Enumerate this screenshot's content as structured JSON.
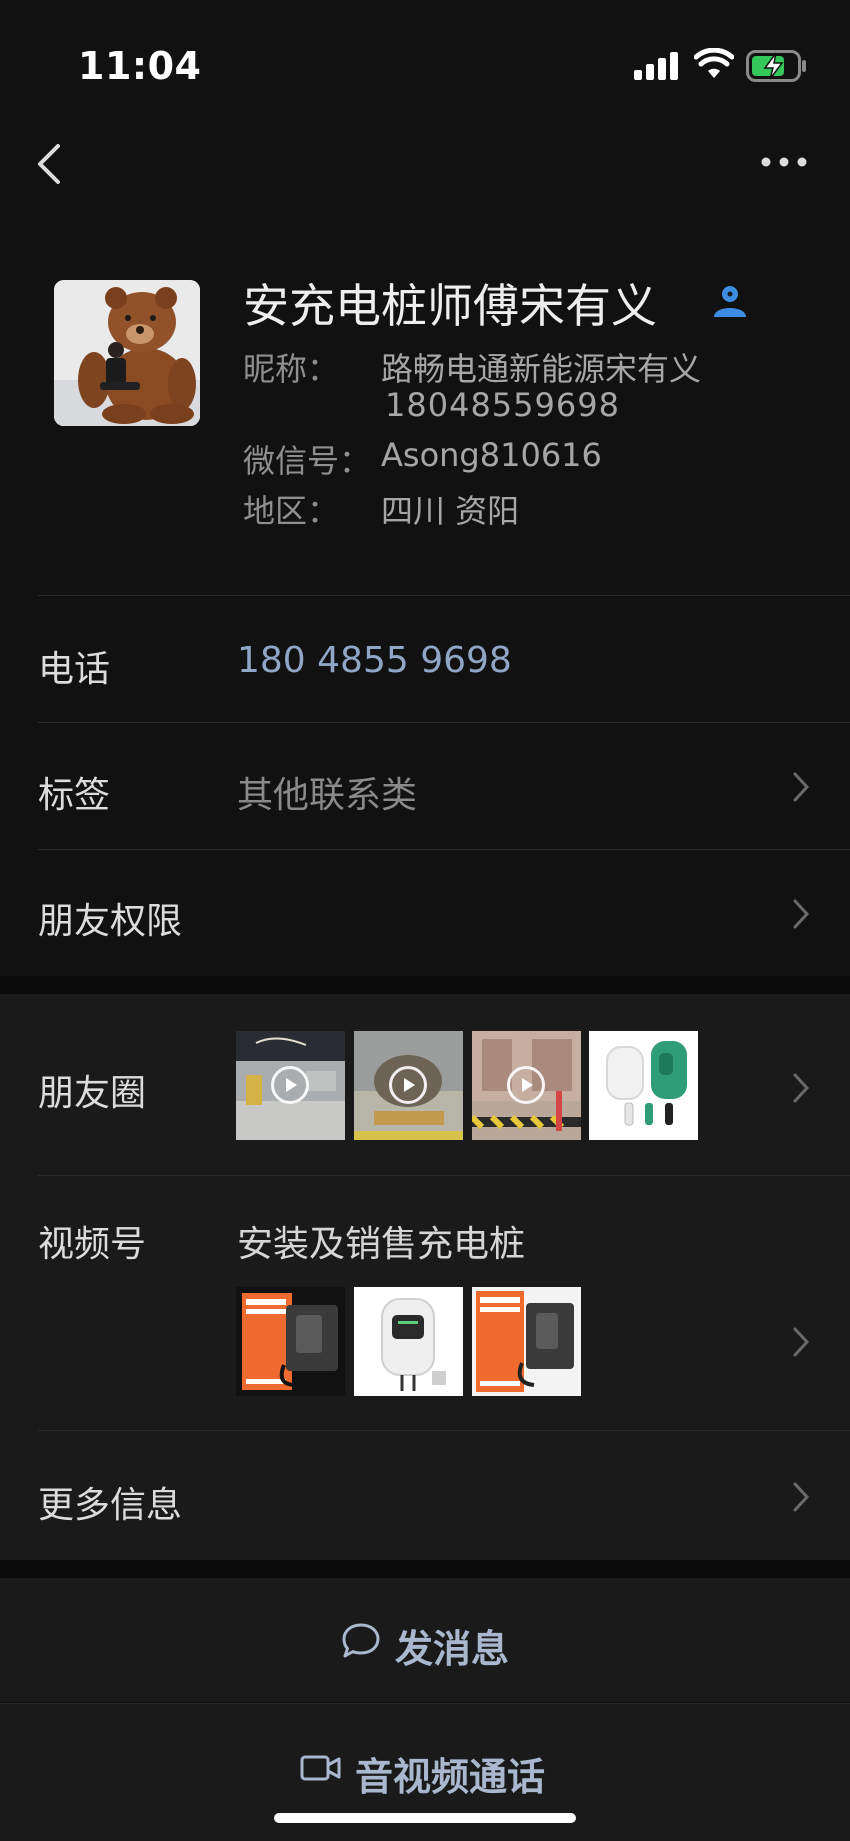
{
  "status_bar": {
    "time": "11:04"
  },
  "profile": {
    "name": "安充电桩师傅宋有义",
    "nickname_label": "昵称：",
    "nickname_line1": "路畅电通新能源宋有义",
    "nickname_line2": "18048559698",
    "wechat_label": "微信号：",
    "wechat_id": "Asong810616",
    "region_label": "地区：",
    "region": "四川 资阳"
  },
  "rows": {
    "phone_label": "电话",
    "phone_value": "180 4855 9698",
    "tag_label": "标签",
    "tag_value": "其他联系类",
    "friend_permission_label": "朋友权限",
    "moments_label": "朋友圈",
    "channels_label": "视频号",
    "channels_title": "安装及销售充电桩",
    "more_info_label": "更多信息"
  },
  "actions": {
    "message": "发消息",
    "call": "音视频通话"
  },
  "colors": {
    "background": "#111111",
    "section": "#1a1a1a",
    "link_blue": "#8fa6c6",
    "action_blue": "#a9b8cf"
  }
}
